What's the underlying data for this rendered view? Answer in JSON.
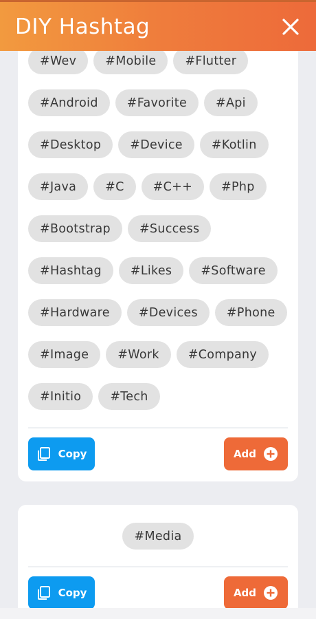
{
  "header": {
    "title": "DIY Hashtag",
    "close_icon": "close-icon",
    "gradient": [
      "#f29a3f",
      "#ed6a3a"
    ]
  },
  "cards": [
    {
      "tags": [
        "#Wev",
        "#Mobile",
        "#Flutter",
        "#Android",
        "#Favorite",
        "#Api",
        "#Desktop",
        "#Device",
        "#Kotlin",
        "#Java",
        "#C",
        "#C++",
        "#Php",
        "#Bootstrap",
        "#Success",
        "#Hashtag",
        "#Likes",
        "#Software",
        "#Hardware",
        "#Devices",
        "#Phone",
        "#Image",
        "#Work",
        "#Company",
        "#Initio",
        "#Tech"
      ],
      "copy_label": "Copy",
      "add_label": "Add"
    },
    {
      "tags": [
        "#Media"
      ],
      "copy_label": "Copy",
      "add_label": "Add"
    }
  ],
  "colors": {
    "copy_button": "#0d9bf0",
    "add_button": "#ee6a38",
    "tag_background": "#e2e2e2"
  }
}
